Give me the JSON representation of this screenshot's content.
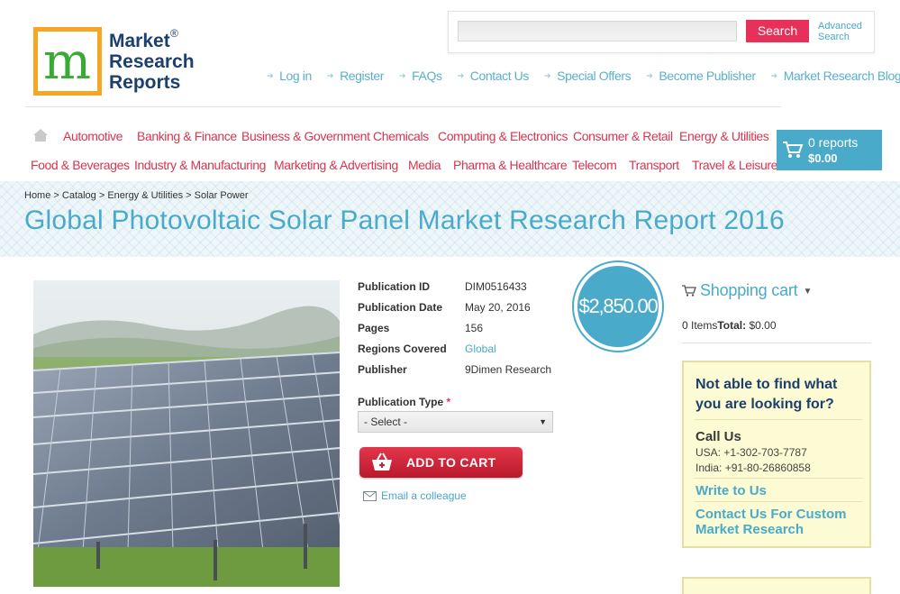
{
  "logo": {
    "line1": "Market",
    "line2": "Research",
    "line3": "Reports",
    "reg": "®",
    "mark": "m"
  },
  "search": {
    "placeholder": "",
    "button": "Search",
    "advanced_line1": "Advanced",
    "advanced_line2": "Search"
  },
  "toplinks": [
    "Log in",
    "Register",
    "FAQs",
    "Contact Us",
    "Special Offers",
    "Become Publisher",
    "Market Research Blog"
  ],
  "categories_row1": [
    "Automotive",
    "Banking & Finance",
    "Business & Government",
    "Chemicals",
    "Computing & Electronics",
    "Consumer & Retail",
    "Energy & Utilities"
  ],
  "categories_row2": [
    "Food & Beverages",
    "Industry & Manufacturing",
    "Marketing & Advertising",
    "Media",
    "Pharma & Healthcare",
    "Telecom",
    "Transport",
    "Travel & Leisure"
  ],
  "cart": {
    "reports": "0 reports",
    "total": "$0.00"
  },
  "breadcrumb": "Home > Catalog > Energy & Utilities > Solar Power",
  "title": "Global Photovoltaic Solar Panel Market Research Report 2016",
  "details": [
    {
      "key": "Publication ID",
      "value": "DIM0516433"
    },
    {
      "key": "Publication Date",
      "value": "May 20, 2016"
    },
    {
      "key": "Pages",
      "value": "156"
    },
    {
      "key": "Regions Covered",
      "value": "Global"
    },
    {
      "key": "Publisher",
      "value": "9Dimen Research"
    }
  ],
  "price": "$2,850.00",
  "publication_type": {
    "label": "Publication Type",
    "required": "*",
    "selected": "- Select -"
  },
  "add_to_cart": "ADD TO CART",
  "email_colleague": "Email a colleague",
  "shopping_cart": {
    "heading": "Shopping cart",
    "items": "0 Items",
    "total_label": "Total:",
    "total_value": "$0.00"
  },
  "help": {
    "heading": "Not able to find what you are looking for?",
    "call_us": "Call Us",
    "usa": "USA: +1-302-703-7787",
    "india": "India: +91-80-26860858",
    "write_to_us": "Write to Us",
    "custom": "Contact Us For Custom Market Research"
  },
  "colors": {
    "accent": "#4aaac9",
    "category": "#d9354e",
    "search_button": "#e8315a",
    "help_bg": "#fcfbd3"
  }
}
